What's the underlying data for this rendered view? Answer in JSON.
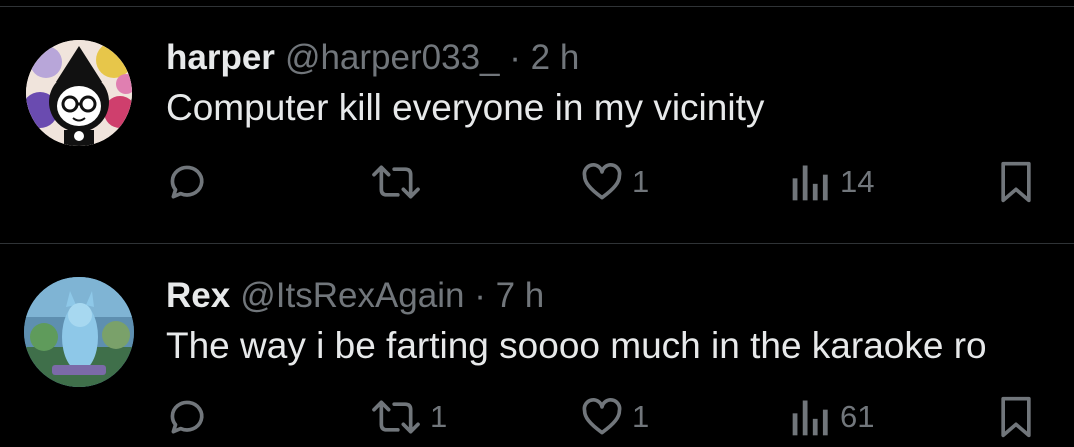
{
  "posts": [
    {
      "name": "harper",
      "handle": "@harper033_",
      "separator": "·",
      "time": "2 h",
      "text": "Computer kill everyone in my vicinity",
      "reply_count": "",
      "repost_count": "",
      "like_count": "1",
      "view_count": "14"
    },
    {
      "name": "Rex",
      "handle": "@ItsRexAgain",
      "separator": "·",
      "time": "7 h",
      "text": "The way i be farting soooo much in the karaoke ro",
      "reply_count": "",
      "repost_count": "1",
      "like_count": "1",
      "view_count": "61"
    }
  ],
  "icons": {
    "reply": "reply-icon",
    "repost": "repost-icon",
    "like": "heart-icon",
    "views": "views-icon",
    "bookmark": "bookmark-icon"
  },
  "colors": {
    "background": "#000000",
    "primary_text": "#e7e9ea",
    "secondary_text": "#71767b",
    "divider": "#2f3336"
  }
}
